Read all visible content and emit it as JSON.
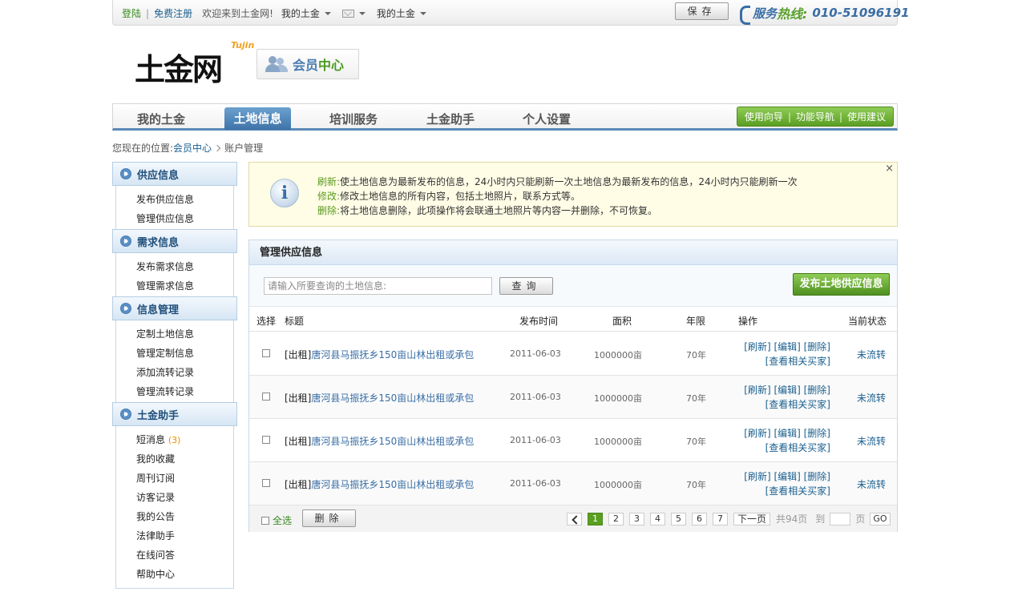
{
  "topbar": {
    "login": "登陆",
    "register": "免费注册",
    "welcome": "欢迎来到土金网!",
    "menu1": "我的土金",
    "menu2": "我的土金",
    "save": "保存",
    "hotline_a": "服务",
    "hotline_b": "热线:",
    "hotline_num": "010-51096191"
  },
  "header": {
    "logo": "土金网",
    "logo_en": "Tujin",
    "member_a": "会员",
    "member_b": "中心"
  },
  "nav": {
    "items": [
      "我的土金",
      "土地信息",
      "培训服务",
      "土金助手",
      "个人设置"
    ],
    "active_index": 1,
    "right": [
      "使用向导",
      "功能导航",
      "使用建议"
    ]
  },
  "breadcrumb": {
    "prefix": "您现在的位置:",
    "link": "会员中心",
    "current": "账户管理"
  },
  "sidebar": {
    "groups": [
      {
        "title": "供应信息",
        "items": [
          "发布供应信息",
          "管理供应信息"
        ]
      },
      {
        "title": "需求信息",
        "items": [
          "发布需求信息",
          "管理需求信息"
        ]
      },
      {
        "title": "信息管理",
        "items": [
          "定制土地信息",
          "管理定制信息",
          "添加流转记录",
          "管理流转记录"
        ]
      },
      {
        "title": "土金助手",
        "items": [
          "短消息",
          "我的收藏",
          "周刊订阅",
          "访客记录",
          "我的公告",
          "法律助手",
          "在线问答",
          "帮助中心"
        ]
      }
    ],
    "message_count": "(3)"
  },
  "notice": {
    "lines": [
      {
        "label": "刷新:",
        "text": "使土地信息为最新发布的信息，24小时内只能刷新一次土地信息为最新发布的信息，24小时内只能刷新一次"
      },
      {
        "label": "修改:",
        "text": "修改土地信息的所有内容，包括土地照片，联系方式等。"
      },
      {
        "label": "删除:",
        "text": "将土地信息删除，此项操作将会联通土地照片等内容一并删除，不可恢复。"
      }
    ],
    "close": "×"
  },
  "panel": {
    "title": "管理供应信息",
    "search_placeholder": "请输入所要查询的土地信息:",
    "query": "查询",
    "publish": "发布土地供应信息",
    "columns": [
      "选择",
      "标题",
      "发布时间",
      "面积",
      "年限",
      "操作",
      "当前状态"
    ],
    "rows": [
      {
        "tag": "[出租]",
        "title": "唐河县马振抚乡150亩山林出租或承包",
        "date": "2011-06-03",
        "area": "1000000亩",
        "years": "70年",
        "ops1": "[刷新] [编辑] [删除]",
        "ops2": "[查看相关买家]",
        "status": "未流转"
      },
      {
        "tag": "[出租]",
        "title": "唐河县马振抚乡150亩山林出租或承包",
        "date": "2011-06-03",
        "area": "1000000亩",
        "years": "70年",
        "ops1": "[刷新] [编辑] [删除]",
        "ops2": "[查看相关买家]",
        "status": "未流转"
      },
      {
        "tag": "[出租]",
        "title": "唐河县马振抚乡150亩山林出租或承包",
        "date": "2011-06-03",
        "area": "1000000亩",
        "years": "70年",
        "ops1": "[刷新] [编辑] [删除]",
        "ops2": "[查看相关买家]",
        "status": "未流转"
      },
      {
        "tag": "[出租]",
        "title": "唐河县马振抚乡150亩山林出租或承包",
        "date": "2011-06-03",
        "area": "1000000亩",
        "years": "70年",
        "ops1": "[刷新] [编辑] [删除]",
        "ops2": "[查看相关买家]",
        "status": "未流转"
      }
    ],
    "select_all": "全选",
    "delete": "删除"
  },
  "pager": {
    "pages": [
      "1",
      "2",
      "3",
      "4",
      "5",
      "6",
      "7"
    ],
    "current": "1",
    "next": "下一页",
    "total": "共94页",
    "to": "到",
    "page_unit": "页",
    "go": "GO"
  }
}
